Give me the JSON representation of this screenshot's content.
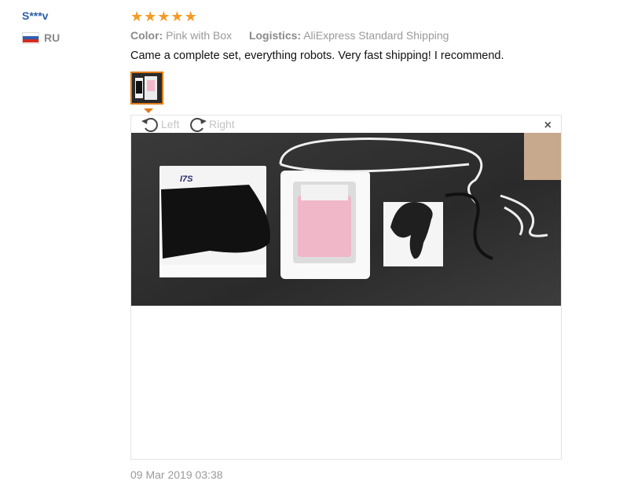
{
  "user": {
    "name": "S***v",
    "country": "RU"
  },
  "rating": {
    "stars": 5,
    "max": 5
  },
  "meta": {
    "color_label": "Color:",
    "color_value": "Pink with Box",
    "logistics_label": "Logistics:",
    "logistics_value": "AliExpress Standard Shipping"
  },
  "review": {
    "text": "Came a complete set, everything robots. Very fast shipping! I recommend."
  },
  "viewer": {
    "rotate_left_label": "Left",
    "rotate_right_label": "Right",
    "close_label": "×",
    "photo_text": "I7S"
  },
  "date": "09 Mar 2019 03:38",
  "colors": {
    "username": "#2b5ea8",
    "star": "#f59a23",
    "thumb_border": "#e07b19",
    "muted_text": "#9a9a9a"
  },
  "icons": [
    "flag-ru-icon",
    "star-icon",
    "rotate-left-icon",
    "rotate-right-icon",
    "close-icon"
  ]
}
